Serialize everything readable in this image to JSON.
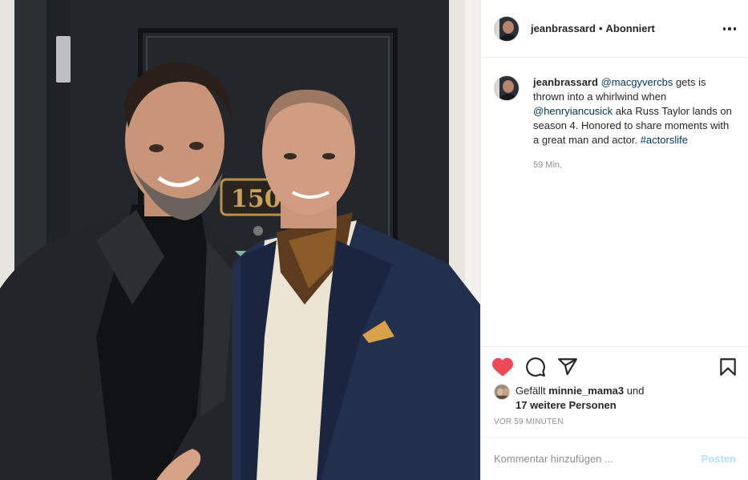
{
  "post": {
    "author": "jeanbrassard",
    "separator": "•",
    "follow_status": "Abonniert",
    "photo": {
      "door_number": "150"
    },
    "caption": {
      "username": "jeanbrassard",
      "mention1": "@macgyvercbs",
      "text1": " gets is thrown into a whirlwind when ",
      "mention2": "@henryiancusick",
      "text2": " aka Russ Taylor lands on season 4. Honored to share moments with a great man and actor. ",
      "hashtag": "#actorslife"
    },
    "caption_time": "59 Min.",
    "likes": {
      "prefix": "Gefällt ",
      "liker": "minnie_mama3",
      "middle": " und",
      "others": "17 weitere Personen"
    },
    "timestamp": "VOR 59 MINUTEN",
    "comment": {
      "placeholder": "Kommentar hinzufügen ...",
      "post_label": "Posten"
    }
  },
  "icons": {
    "more": "more-options-icon",
    "like": "heart-filled-icon",
    "comment": "comment-bubble-icon",
    "share": "paper-plane-icon",
    "save": "bookmark-icon"
  },
  "colors": {
    "like_red": "#ed4956",
    "link_blue": "#00376b",
    "muted_gray": "#8e8e8e",
    "post_disabled": "#b2dffc",
    "border": "#efefef"
  }
}
